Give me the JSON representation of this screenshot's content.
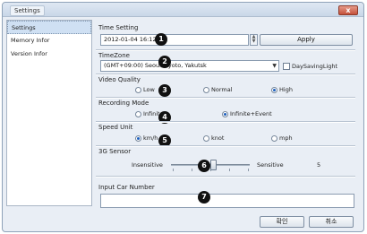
{
  "window": {
    "title": "Settings",
    "close_label": "x"
  },
  "sidebar": {
    "items": [
      {
        "label": "Settings",
        "active": true
      },
      {
        "label": "Memory Infor",
        "active": false
      },
      {
        "label": "Version Infor",
        "active": false
      }
    ]
  },
  "time_setting": {
    "label": "Time Setting",
    "value": "2012-01-04 16:12:51",
    "apply_label": "Apply"
  },
  "timezone": {
    "label": "TimeZone",
    "value": "(GMT+09:00) Seoul, Kyoto, Yakutsk",
    "dst_label": "DaySavingLight",
    "dst_checked": false
  },
  "video_quality": {
    "label": "Video Quality",
    "options": [
      "Low",
      "Normal",
      "High"
    ],
    "selected": "High"
  },
  "recording_mode": {
    "label": "Recording Mode",
    "options": [
      "Infinite",
      "Infinite+Event"
    ],
    "selected": "Infinite+Event"
  },
  "speed_unit": {
    "label": "Speed Unit",
    "options": [
      "km/h",
      "knot",
      "mph"
    ],
    "selected": "km/h"
  },
  "g_sensor": {
    "label": "3G Sensor",
    "min_label": "Insensitive",
    "max_label": "Sensitive",
    "value": "5"
  },
  "car_number": {
    "label": "Input Car Number",
    "value": ""
  },
  "badges": [
    "1",
    "2",
    "3",
    "4",
    "5",
    "6",
    "7"
  ],
  "footer": {
    "ok_label": "확인",
    "cancel_label": "취소"
  },
  "colors": {
    "accent": "#1c5fbf",
    "window_bg": "#e9eef5",
    "close": "#c4503a"
  }
}
